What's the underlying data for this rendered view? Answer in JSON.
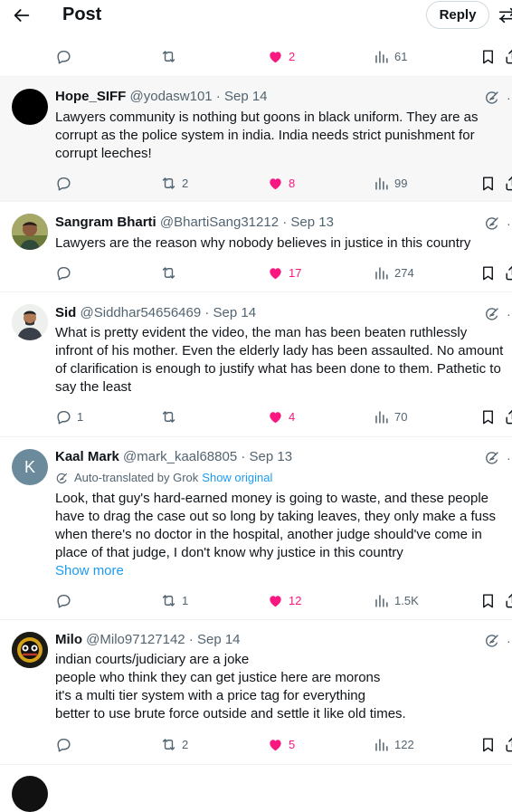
{
  "header": {
    "title": "Post",
    "reply_label": "Reply"
  },
  "top_actions": {
    "likes": "2",
    "views": "61"
  },
  "tweets": [
    {
      "name": "Hope_SIFF",
      "handle": "@yodasw101",
      "date": "Sep 14",
      "text": "Lawyers community is nothing but goons in black uniform. They are as\ncorrupt as the police system in india. India needs strict punishment for\ncorrupt leeches!",
      "replies": "",
      "reposts": "2",
      "likes": "8",
      "views": "99"
    },
    {
      "name": "Sangram Bharti",
      "handle": "@BhartiSang31212",
      "date": "Sep 13",
      "text": "Lawyers are the reason why nobody believes in justice in this country",
      "replies": "",
      "reposts": "",
      "likes": "17",
      "views": "274"
    },
    {
      "name": "Sid",
      "handle": "@Siddhar54656469",
      "date": "Sep 14",
      "text": "What is pretty evident the video, the man has been beaten ruthlessly\ninfront of his mother. Even the elderly lady has been assaulted. No amount\nof clarification is enough to justify what has been done to them. Pathetic to\nsay the least",
      "replies": "1",
      "reposts": "",
      "likes": "4",
      "views": "70"
    },
    {
      "name": "Kaal Mark",
      "handle": "@mark_kaal68805",
      "date": "Sep 13",
      "avatar_letter": "K",
      "translated_label": "Auto-translated by Grok",
      "show_original": "Show original",
      "text": "Look, that guy's hard-earned money is going to waste, and these people\nhave to drag the case out so long by taking leaves, they only make a fuss\nwhen there's no doctor in the hospital, another judge should've come in\nplace of that judge, I don't know why justice in this country",
      "show_more": "Show more",
      "replies": "",
      "reposts": "1",
      "likes": "12",
      "views": "1.5K"
    },
    {
      "name": "Milo",
      "handle": "@Milo97127142",
      "date": "Sep 14",
      "text": "indian courts/judiciary are a joke\npeople who think they can get justice here are morons\nit's a multi tier system with a price tag for everything\nbetter to use brute force outside and settle it like old times.",
      "replies": "",
      "reposts": "2",
      "likes": "5",
      "views": "122"
    }
  ],
  "colors": {
    "like": "#f91880",
    "link": "#1d9bf0",
    "muted": "#536471",
    "avatar_k": "#6b8a9c"
  },
  "icons": [
    "back-arrow-icon",
    "filter-icon",
    "reply-icon",
    "repost-icon",
    "like-icon",
    "views-icon",
    "bookmark-icon",
    "share-icon",
    "grok-icon",
    "more-icon"
  ]
}
